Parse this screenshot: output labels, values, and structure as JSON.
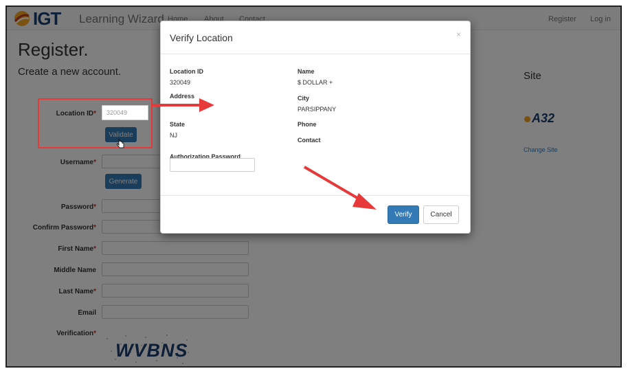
{
  "navbar": {
    "brand_igt": "IGT",
    "brand_name": "Learning Wizard",
    "links": [
      "Home",
      "About",
      "Contact"
    ],
    "register": "Register",
    "login": "Log in"
  },
  "page": {
    "title": "Register.",
    "subtitle": "Create a new account."
  },
  "form": {
    "location_id_label": "Location ID",
    "location_id_value": "320049",
    "validate_button": "Validate",
    "username_label": "Username",
    "generate_button": "Generate",
    "password_label": "Password",
    "confirm_password_label": "Confirm Password",
    "first_name_label": "First Name",
    "middle_name_label": "Middle Name",
    "last_name_label": "Last Name",
    "email_label": "Email",
    "verification_label": "Verification",
    "required_mark": "*",
    "captcha_text": "WVBNS"
  },
  "site": {
    "title": "Site",
    "logo_text": "A32",
    "change_site": "Change Site"
  },
  "modal": {
    "title": "Verify Location",
    "close": "×",
    "location_id_label": "Location ID",
    "location_id_value": "320049",
    "name_label": "Name",
    "name_value": "$ DOLLAR +",
    "address_label": "Address",
    "city_label": "City",
    "city_value": "PARSIPPANY",
    "state_label": "State",
    "state_value": "NJ",
    "phone_label": "Phone",
    "contact_label": "Contact",
    "auth_password_label": "Authorization Password",
    "verify_button": "Verify",
    "cancel_button": "Cancel"
  },
  "colors": {
    "primary": "#337ab7",
    "annotation": "#e8393a",
    "brand": "#1a3d6e"
  }
}
